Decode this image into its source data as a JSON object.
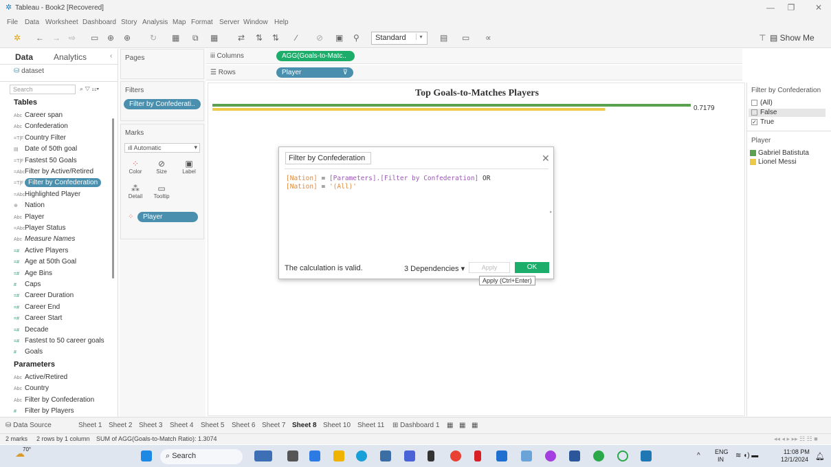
{
  "window": {
    "title": "Tableau - Book2 [Recovered]"
  },
  "menu": [
    "File",
    "Data",
    "Worksheet",
    "Dashboard",
    "Story",
    "Analysis",
    "Map",
    "Format",
    "Server",
    "Window",
    "Help"
  ],
  "toolbar": {
    "fit": "Standard",
    "show_me": "Show Me"
  },
  "left_panel": {
    "tab_data": "Data",
    "tab_analytics": "Analytics",
    "datasource": "dataset",
    "search_placeholder": "Search",
    "tables_header": "Tables",
    "fields": [
      {
        "icon": "Abc",
        "label": "Career span"
      },
      {
        "icon": "Abc",
        "label": "Confederation"
      },
      {
        "icon": "=T|F",
        "label": "Country Filter"
      },
      {
        "icon": "cal",
        "label": "Date of 50th goal"
      },
      {
        "icon": "=T|F",
        "label": "Fastest 50 Goals"
      },
      {
        "icon": "=Abc",
        "label": "Filter by Active/Retired"
      },
      {
        "icon": "=T|F",
        "label": "Filter by Confederation"
      },
      {
        "icon": "=Abc",
        "label": "Highlighted Player"
      },
      {
        "icon": "geo",
        "label": "Nation"
      },
      {
        "icon": "Abc",
        "label": "Player"
      },
      {
        "icon": "=Abc",
        "label": "Player Status"
      },
      {
        "icon": "Abc",
        "label": "Measure Names"
      },
      {
        "icon": "=#",
        "label": "Active Players"
      },
      {
        "icon": "=#",
        "label": "Age at 50th Goal"
      },
      {
        "icon": "=#",
        "label": "Age Bins"
      },
      {
        "icon": "#",
        "label": "Caps"
      },
      {
        "icon": "=#",
        "label": "Career Duration"
      },
      {
        "icon": "=#",
        "label": "Career End"
      },
      {
        "icon": "=#",
        "label": "Career Start"
      },
      {
        "icon": "=#",
        "label": "Decade"
      },
      {
        "icon": "=#",
        "label": "Fastest to 50 career goals"
      },
      {
        "icon": "#",
        "label": "Goals"
      }
    ],
    "parameters_header": "Parameters",
    "parameters": [
      {
        "icon": "Abc",
        "label": "Active/Retired"
      },
      {
        "icon": "Abc",
        "label": "Country"
      },
      {
        "icon": "Abc",
        "label": "Filter by Confederation"
      },
      {
        "icon": "#",
        "label": "Filter by Players"
      }
    ]
  },
  "cards": {
    "pages": "Pages",
    "filters": "Filters",
    "filter_pill": "Filter by Confederati..",
    "marks": "Marks",
    "mark_type": "Automatic",
    "mark_buttons": [
      "Color",
      "Size",
      "Label",
      "Detail",
      "Tooltip"
    ],
    "marks_pill": "Player"
  },
  "shelves": {
    "columns_label": "Columns",
    "columns_pill": "AGG(Goals-to-Matc..",
    "rows_label": "Rows",
    "rows_pill": "Player"
  },
  "chart_data": {
    "type": "bar",
    "title": "Top Goals-to-Matches Players",
    "categories": [
      "Gabriel Batistuta",
      "Lionel Messi"
    ],
    "values": [
      0.7179,
      0.5895
    ],
    "colors": [
      "#59a14f",
      "#edc948"
    ],
    "data_label": "0.7179",
    "xlim": [
      0,
      0.75
    ]
  },
  "right_panel": {
    "filter_title": "Filter by Confederation",
    "options": [
      {
        "label": "(All)",
        "checked": false
      },
      {
        "label": "False",
        "checked": false
      },
      {
        "label": "True",
        "checked": true
      }
    ],
    "legend_title": "Player",
    "legend": [
      {
        "label": "Gabriel Batistuta",
        "color": "#59a14f"
      },
      {
        "label": "Lionel Messi",
        "color": "#edc948"
      }
    ]
  },
  "dialog": {
    "name": "Filter by Confederation",
    "code_line1_field": "[Nation]",
    "code_line1_eq": " = ",
    "code_line1_param": "[Parameters].[Filter by Confederation]",
    "code_line1_or": " OR",
    "code_line2_field": "[Nation]",
    "code_line2_eq": " = ",
    "code_line2_str": "'(All)'",
    "status": "The calculation is valid.",
    "dependencies": "3 Dependencies",
    "apply": "Apply",
    "ok": "OK",
    "apply_tooltip": "Apply (Ctrl+Enter)"
  },
  "sheet_tabs": [
    "Data Source",
    "Sheet 1",
    "Sheet 2",
    "Sheet 3",
    "Sheet 4",
    "Sheet 5",
    "Sheet 6",
    "Sheet 7",
    "Sheet 8",
    "Sheet 10",
    "Sheet 11",
    "Dashboard 1"
  ],
  "active_tab": "Sheet 8",
  "status": {
    "marks": "2 marks",
    "rows": "2 rows by 1 column",
    "sum": "SUM of AGG(Goals-to-Match Ratio): 1.3074"
  },
  "taskbar": {
    "weather": "70°",
    "search": "Search",
    "lang1": "ENG",
    "lang2": "IN",
    "time": "11:08 PM",
    "date": "12/1/2024"
  }
}
